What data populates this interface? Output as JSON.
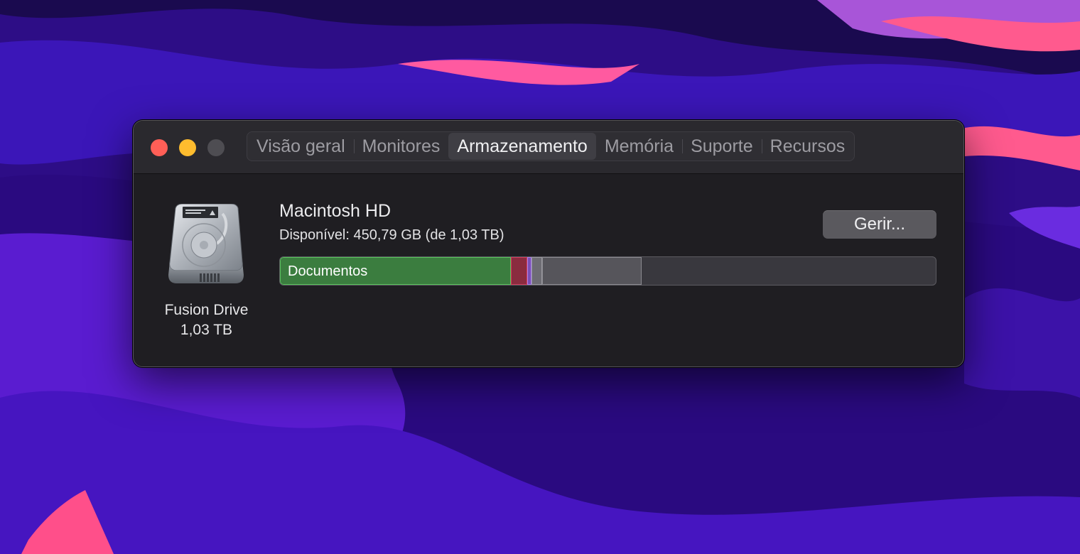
{
  "window": {
    "tabs": [
      {
        "label": "Visão geral",
        "active": false
      },
      {
        "label": "Monitores",
        "active": false
      },
      {
        "label": "Armazenamento",
        "active": true
      },
      {
        "label": "Memória",
        "active": false
      },
      {
        "label": "Suporte",
        "active": false
      },
      {
        "label": "Recursos",
        "active": false
      }
    ]
  },
  "disk": {
    "name": "Fusion Drive",
    "size": "1,03 TB",
    "icon": "hard-drive-icon"
  },
  "volume": {
    "name": "Macintosh HD",
    "available": "Disponível: 450,79 GB (de 1,03 TB)",
    "manage_label": "Gerir...",
    "usage_bar": {
      "total_tb": 1.03,
      "available_gb": 450.79,
      "segments": [
        {
          "name": "Documentos",
          "label": "Documentos",
          "fraction": 0.352,
          "color": "#3b7d3f"
        },
        {
          "name": "apps",
          "label": "",
          "fraction": 0.025,
          "color": "#8a2b3f"
        },
        {
          "name": "other-purple",
          "label": "",
          "fraction": 0.006,
          "color": "#7b4fb8"
        },
        {
          "name": "other-light",
          "label": "",
          "fraction": 0.016,
          "color": "#6d6c73"
        },
        {
          "name": "system",
          "label": "",
          "fraction": 0.152,
          "color": "#56555b"
        }
      ]
    }
  },
  "colors": {
    "close": "#ff5f57",
    "minimize": "#febc2e",
    "zoom_disabled": "#4e4d52",
    "window_bg": "#1f1e22"
  }
}
